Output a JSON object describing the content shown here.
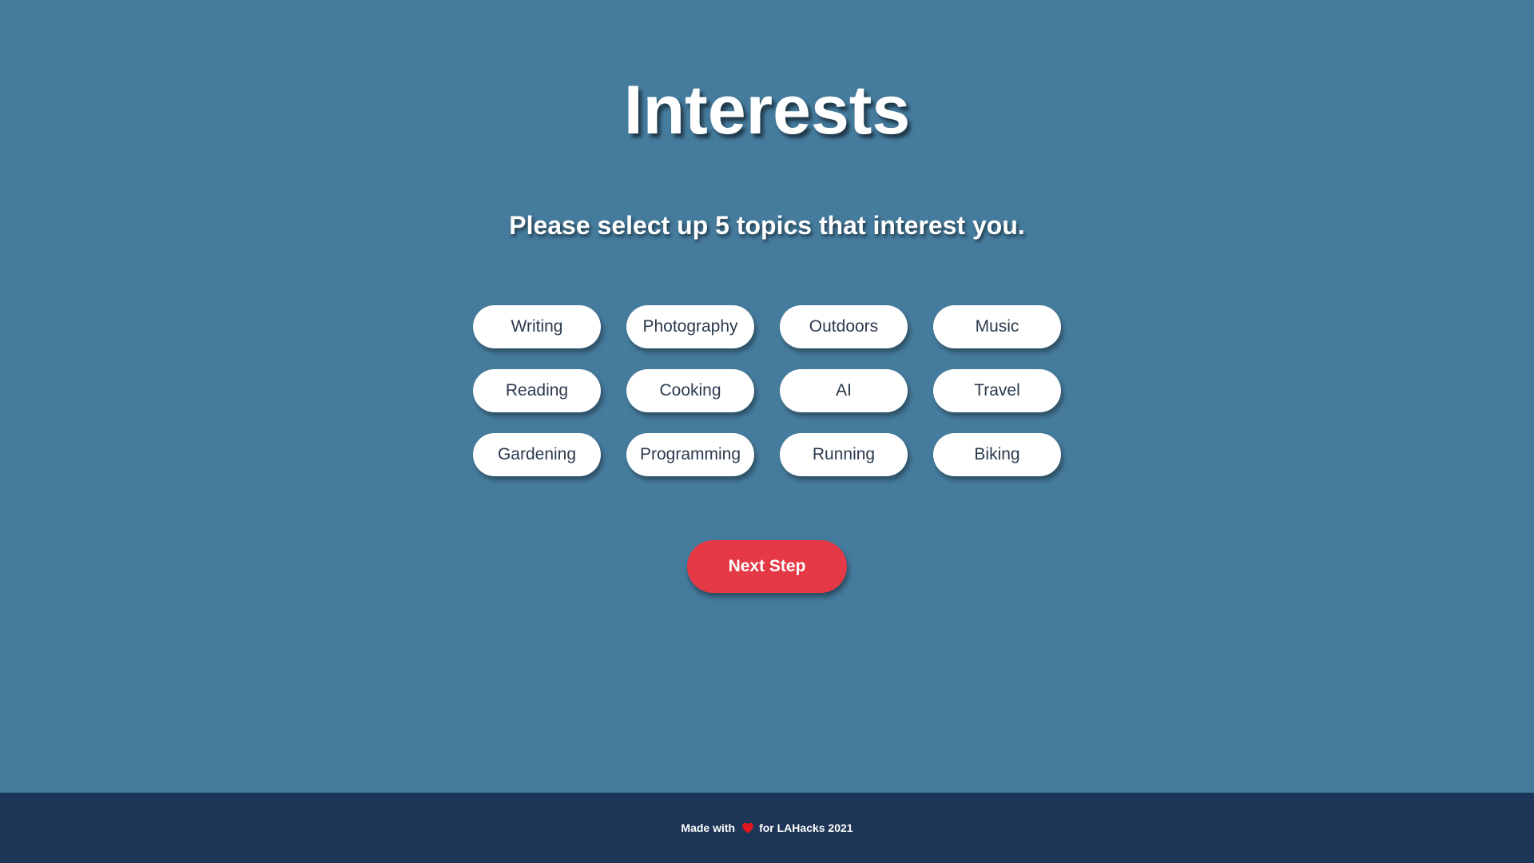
{
  "page": {
    "title": "Interests",
    "subtitle": "Please select up 5 topics that interest you."
  },
  "topics": [
    {
      "label": "Writing"
    },
    {
      "label": "Photography"
    },
    {
      "label": "Outdoors"
    },
    {
      "label": "Music"
    },
    {
      "label": "Reading"
    },
    {
      "label": "Cooking"
    },
    {
      "label": "AI"
    },
    {
      "label": "Travel"
    },
    {
      "label": "Gardening"
    },
    {
      "label": "Programming"
    },
    {
      "label": "Running"
    },
    {
      "label": "Biking"
    }
  ],
  "actions": {
    "next_label": "Next Step"
  },
  "footer": {
    "prefix": "Made with",
    "heart_icon": "heart-icon",
    "suffix": "for LAHacks 2021"
  },
  "colors": {
    "background": "#457b9d",
    "footer": "#1d3557",
    "accent": "#e63946",
    "pill_text": "#2b3a4e"
  }
}
